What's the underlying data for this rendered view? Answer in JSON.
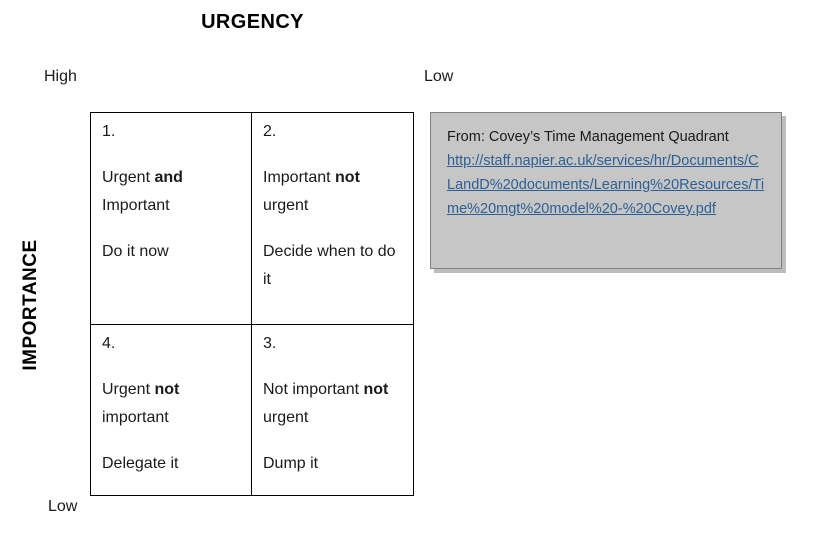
{
  "axes": {
    "horizontal_title": "URGENCY",
    "horizontal_left_label": "High",
    "horizontal_right_label": "Low",
    "vertical_title": "IMPORTANCE",
    "vertical_bottom_label": "Low"
  },
  "quadrants": [
    {
      "number": "1.",
      "description_prefix": "Urgent ",
      "description_emphasis": "and",
      "description_suffix": " Important",
      "action": "Do it now"
    },
    {
      "number": "2.",
      "description_prefix": "Important ",
      "description_emphasis": "not",
      "description_suffix": " urgent",
      "action": "Decide when to do it"
    },
    {
      "number": "4.",
      "description_prefix": "Urgent ",
      "description_emphasis": "not",
      "description_suffix": " important",
      "action": "Delegate it"
    },
    {
      "number": "3.",
      "description_prefix": "Not important ",
      "description_emphasis": "not",
      "description_suffix": " urgent",
      "action": "Dump it"
    }
  ],
  "source": {
    "caption": "From: Covey’s Time Management Quadrant",
    "url": "http://staff.napier.ac.uk/services/hr/Documents/CLandD%20documents/Learning%20Resources/Time%20mgt%20model%20-%20Covey.pdf"
  },
  "colors": {
    "link": "#2e5f94",
    "source_box_fill": "#c6c6c6",
    "source_box_border": "#808080",
    "grid_border": "#000000",
    "text": "#1a1a1a"
  }
}
